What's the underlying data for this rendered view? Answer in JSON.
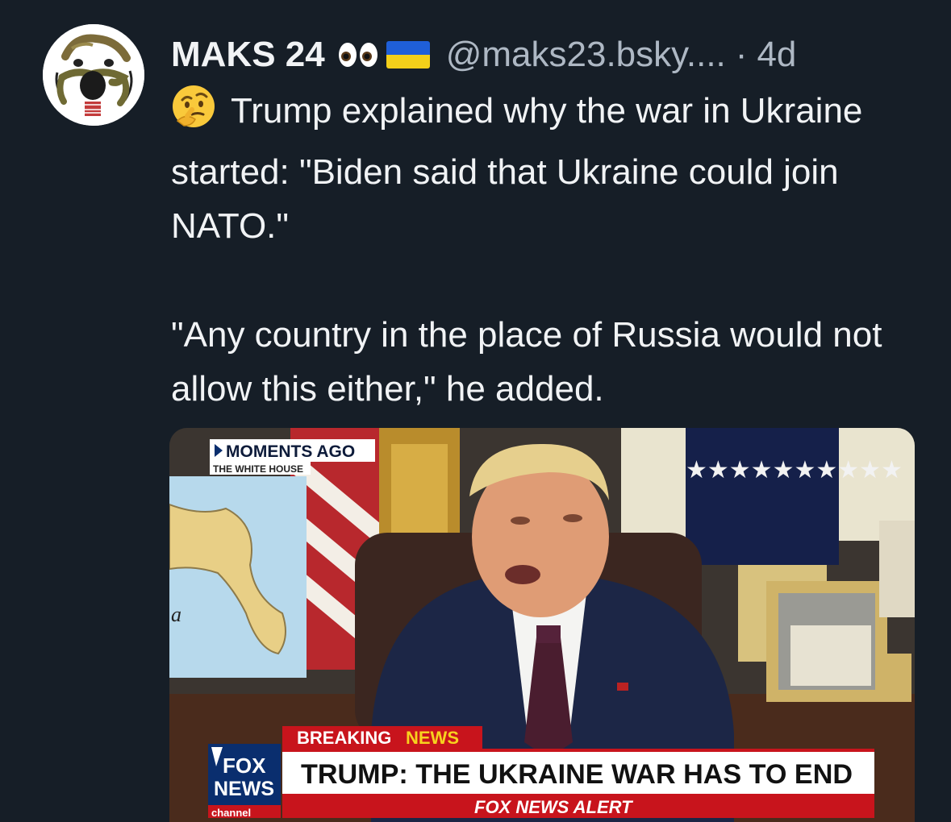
{
  "author": {
    "display_name": "MAKS 24",
    "handle": "@maks23.bsky....",
    "separator": "·",
    "time": "4d",
    "decorations": [
      "eyes-emoji",
      "ukraine-flag-emoji"
    ]
  },
  "post": {
    "leading_emoji": "thinking-face-emoji",
    "paragraph1": "Trump explained why the war in Ukraine started: \"Biden said that Ukraine could join NATO.\"",
    "paragraph2": "\"Any country in the place of Russia would not allow this either,\" he added."
  },
  "media": {
    "top_tag": "MOMENTS AGO",
    "location": "THE WHITE HOUSE",
    "map_letter": "a",
    "breaking_label_1": "BREAKING",
    "breaking_label_2": "NEWS",
    "headline": "TRUMP: THE UKRAINE WAR HAS TO END",
    "logo_line1": "FOX",
    "logo_line2": "NEWS",
    "logo_line3": "channel",
    "alert": "FOX NEWS ALERT"
  },
  "colors": {
    "background": "#161e27",
    "text": "#f1f3f5",
    "muted": "#aeb8c4",
    "fox_red": "#c8141c",
    "fox_blue": "#0a2e6e"
  }
}
